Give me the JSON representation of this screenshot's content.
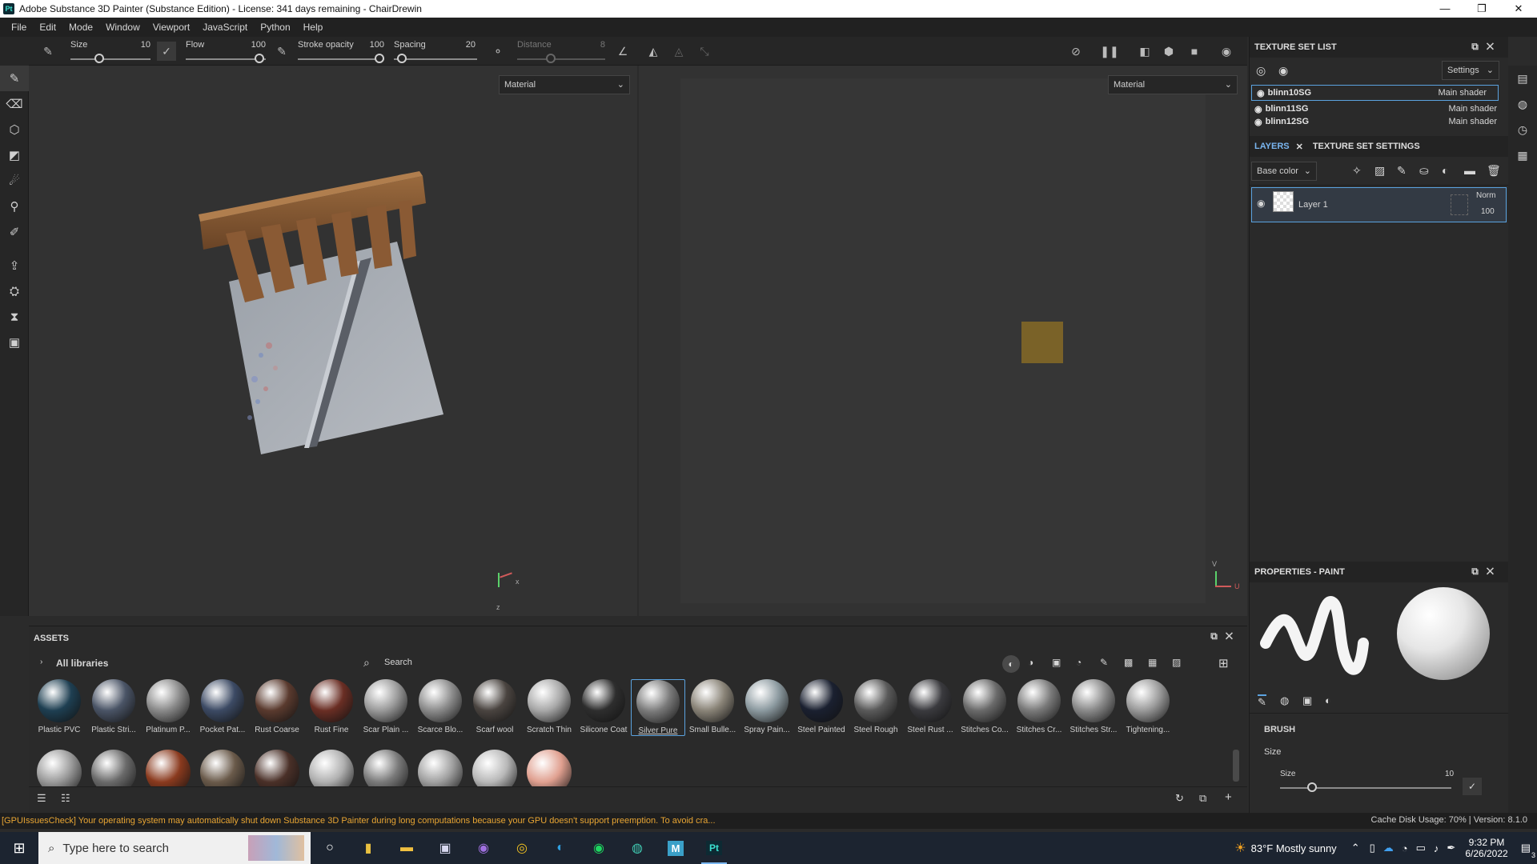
{
  "window": {
    "app_badge": "Pt",
    "title": "Adobe Substance 3D Painter (Substance Edition) - License: 341 days remaining - ChairDrewin",
    "controls": [
      "—",
      "❐",
      "✕"
    ]
  },
  "menu": [
    "File",
    "Edit",
    "Mode",
    "Window",
    "Viewport",
    "JavaScript",
    "Python",
    "Help"
  ],
  "tool_options": {
    "size_label": "Size",
    "size_value": "10",
    "flow_label": "Flow",
    "flow_value": "100",
    "stroke_opacity_label": "Stroke opacity",
    "stroke_opacity_value": "100",
    "spacing_label": "Spacing",
    "spacing_value": "20",
    "distance_label": "Distance",
    "distance_value": "8"
  },
  "viewport3d": {
    "mode": "Material",
    "axis_x": "x",
    "axis_z": "z"
  },
  "viewport2d": {
    "mode": "Material",
    "axis_v": "V",
    "axis_u": "U"
  },
  "texture_set_list": {
    "title": "TEXTURE SET LIST",
    "settings_label": "Settings",
    "rows": [
      {
        "name": "blinn10SG",
        "shader": "Main shader"
      },
      {
        "name": "blinn11SG",
        "shader": "Main shader"
      },
      {
        "name": "blinn12SG",
        "shader": "Main shader"
      }
    ]
  },
  "layers": {
    "tab_layers": "LAYERS",
    "tab_settings": "TEXTURE SET SETTINGS",
    "channel": "Base color",
    "layer_name": "Layer 1",
    "blend_mode": "Norm",
    "opacity": "100"
  },
  "properties": {
    "title": "PROPERTIES - PAINT",
    "section": "BRUSH",
    "size_group": "Size",
    "size_label": "Size",
    "size_value": "10"
  },
  "assets": {
    "title": "ASSETS",
    "library": "All libraries",
    "search_placeholder": "Search",
    "row1": [
      {
        "label": "Plastic PVC",
        "color": "#1e3f52"
      },
      {
        "label": "Plastic Stri...",
        "color": "#4a5466"
      },
      {
        "label": "Platinum P...",
        "color": "#8a8a8a"
      },
      {
        "label": "Pocket Pat...",
        "color": "#3c4a64"
      },
      {
        "label": "Rust Coarse",
        "color": "#5a3a2e"
      },
      {
        "label": "Rust Fine",
        "color": "#6a2e24"
      },
      {
        "label": "Scar Plain ...",
        "color": "#9a9a9a"
      },
      {
        "label": "Scarce Blo...",
        "color": "#8c8c8c"
      },
      {
        "label": "Scarf wool",
        "color": "#4a4440"
      },
      {
        "label": "Scratch Thin",
        "color": "#a8a8a8"
      },
      {
        "label": "Silicone Coat",
        "color": "#2e2e2e"
      },
      {
        "label": "Silver Pure",
        "color": "#7a7a7a"
      },
      {
        "label": "Small Bulle...",
        "color": "#8a8478"
      },
      {
        "label": "Spray Pain...",
        "color": "#8c9aa0"
      },
      {
        "label": "Steel Painted",
        "color": "#1a2030"
      },
      {
        "label": "Steel Rough",
        "color": "#5a5a5a"
      },
      {
        "label": "Steel Rust ...",
        "color": "#3a3a3e"
      },
      {
        "label": "Stitches Co...",
        "color": "#6a6a6a"
      },
      {
        "label": "Stitches Cr...",
        "color": "#7a7a7a"
      },
      {
        "label": "Stitches Str...",
        "color": "#8a8a8a"
      },
      {
        "label": "Tightening...",
        "color": "#9a9a9a"
      }
    ],
    "row2_colors": [
      "#9a9a9a",
      "#6a6a6a",
      "#8a3a1e",
      "#6a5a4a",
      "#4a3028",
      "#b0b0b0",
      "#7a7a7a",
      "#a0a0a0",
      "#b8b8b8",
      "#e0a090"
    ]
  },
  "status": {
    "warning": "[GPUIssuesCheck] Your operating system may automatically shut down Substance 3D Painter during long computations because your GPU doesn't support preemption. To avoid cra...",
    "cache": "Cache Disk Usage:   70% | Version: 8.1.0"
  },
  "taskbar": {
    "search_placeholder": "Type here to search",
    "weather": "83°F  Mostly sunny",
    "time": "9:32 PM",
    "date": "6/26/2022",
    "notif_count": "3"
  }
}
